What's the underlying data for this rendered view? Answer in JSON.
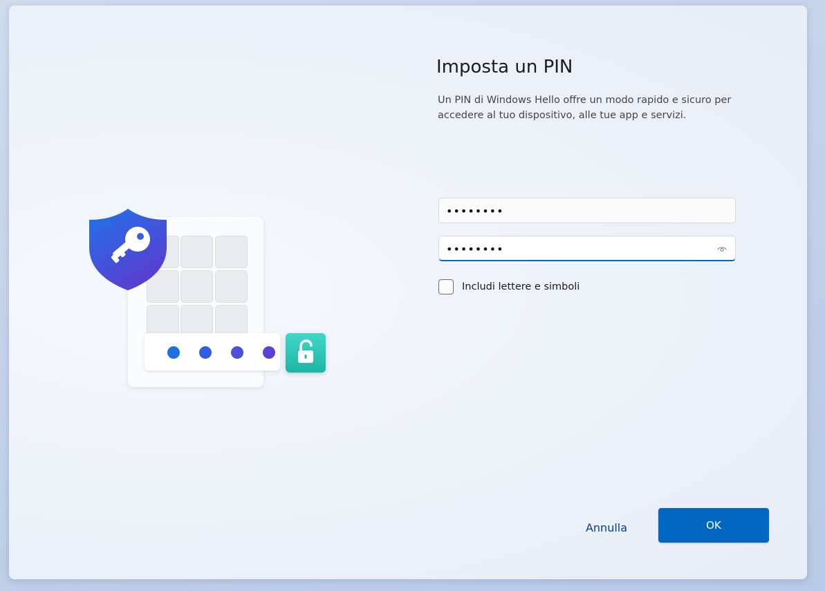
{
  "dialog": {
    "title": "Imposta un PIN",
    "description": "Un PIN di Windows Hello offre un modo rapido e sicuro per accedere al tuo dispositivo, alle tue app e servizi."
  },
  "pin_field": {
    "value": "••••••••"
  },
  "confirm_pin_field": {
    "value": "••••••••",
    "reveal_icon": "eye-icon"
  },
  "include_letters": {
    "label": "Includi lettere e simboli",
    "checked": false
  },
  "buttons": {
    "cancel_label": "Annulla",
    "ok_label": "OK"
  },
  "illustration": {
    "icons": [
      "shield-key-icon",
      "keypad-icon",
      "unlocked-padlock-icon"
    ]
  },
  "colors": {
    "accent": "#0067c0",
    "cancel_text": "#003e92",
    "shield_top": "#1f6fe0",
    "shield_bottom": "#5a3fd0",
    "lock_tile": "#2cc6b6"
  }
}
